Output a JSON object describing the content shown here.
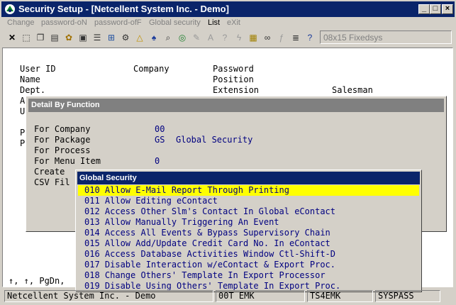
{
  "window": {
    "title": "Security Setup - [Netcellent System Inc. - Demo]",
    "controls": [
      "_",
      "□",
      "X"
    ]
  },
  "menu": [
    "Change",
    "password-oN",
    "password-ofF",
    "Global security",
    "List",
    "eXit"
  ],
  "toolbar": {
    "icons": [
      "close-x-icon",
      "select-icon",
      "copy-icon",
      "paste-icon",
      "settings-icon",
      "print-icon",
      "list-icon",
      "export-icon",
      "warning-icon",
      "binoculars-icon",
      "search-icon",
      "globe-icon",
      "edit-icon",
      "query-icon",
      "lightning-icon",
      "calc-icon",
      "link-icon",
      "script-icon",
      "stack-icon",
      "help-icon"
    ],
    "font": "08x15 Fixedsys"
  },
  "screen": {
    "user_id_label": "User ID",
    "company_label": "Company",
    "password_label": "Password",
    "name_label": "Name",
    "position_label": "Position",
    "dept_label": "Dept.",
    "extension_label": "Extension",
    "salesman_label": "Salesman",
    "row_a": "A",
    "row_u": "U",
    "row_p1": "P",
    "row_p2": "P",
    "bottom_hint": "↑, ↑, PgDn,"
  },
  "detail": {
    "title": "Detail By Function",
    "for_company_label": "For Company",
    "for_company_value": "00",
    "for_package_label": "For Package",
    "for_package_code": "GS",
    "for_package_name": "Global Security",
    "for_process_label": "For Process",
    "for_menu_item_label": "For Menu Item",
    "for_menu_item_value": "0",
    "create_label": "Create",
    "csv_label": "CSV Fil"
  },
  "popup": {
    "title": "Global Security",
    "items": [
      "010 Allow E-Mail Report Through Printing",
      "011 Allow Editing eContact",
      "012 Access Other Slm's Contact In Global eContact",
      "013 Allow Manually Triggering An Event",
      "014 Access All Events & Bypass Supervisory Chain",
      "015 Allow Add/Update Credit Card No. In eContact",
      "016 Access Database Activities Window Ctl-Shift-D",
      "017 Disable Interaction w/eContact & Export Proc.",
      "018 Change Others' Template In Export Processor",
      "019 Disable Using Others' Template In Export Proc."
    ],
    "selected_index": 0
  },
  "status": [
    "Netcellent System Inc. - Demo",
    "00T EMK",
    "TS4EMK",
    "SYSPASS"
  ]
}
